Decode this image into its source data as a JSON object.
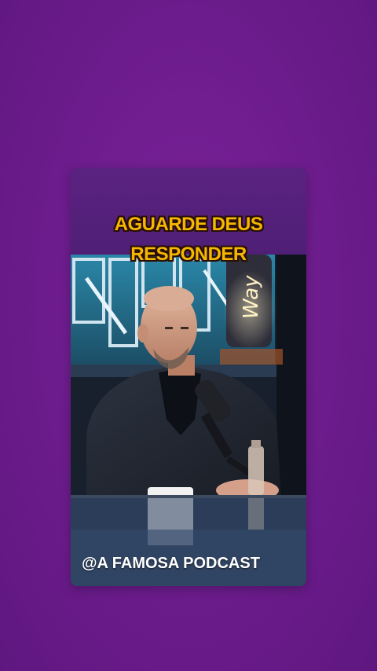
{
  "background_color": "#6c1c8c",
  "accent_text_color": "#f5b800",
  "caption": {
    "line1": "AGUARDE DEUS",
    "line2": "RESPONDER"
  },
  "handle": "@A FAMOSA PODCAST"
}
